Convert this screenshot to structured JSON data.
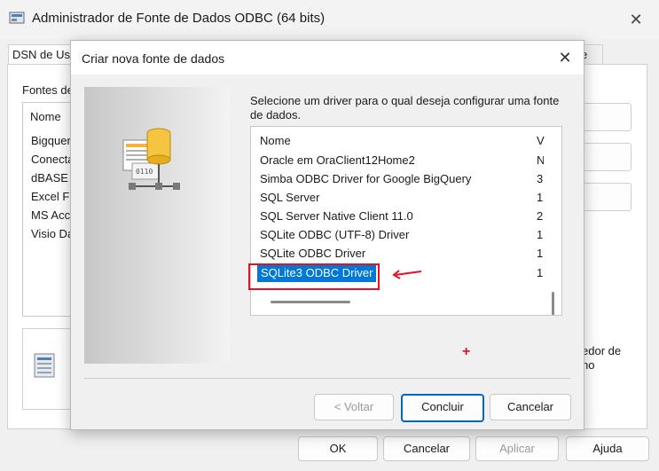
{
  "main_window": {
    "title": "Administrador de Fonte de Dados ODBC (64 bits)",
    "tab_label": "DSN de Us",
    "tab_label_right": "e",
    "fontes_label": "Fontes de",
    "list_header": "Nome",
    "list_items": [
      "Bigquer",
      "Conecta",
      "dBASE",
      "Excel Fi",
      "MS Acc",
      "Visio Da"
    ],
    "info_text_line1": "edor de",
    "info_text_line2": "no",
    "buttons": {
      "ok": "OK",
      "cancel": "Cancelar",
      "apply": "Aplicar",
      "help": "Ajuda"
    }
  },
  "dialog": {
    "title": "Criar nova fonte de dados",
    "prompt": "Selecione um driver para o qual deseja configurar uma fonte de dados.",
    "columns": {
      "name": "Nome",
      "version": "V"
    },
    "drivers": [
      {
        "name": "Oracle em OraClient12Home2",
        "version": "N"
      },
      {
        "name": "Simba ODBC Driver for Google BigQuery",
        "version": "3"
      },
      {
        "name": "SQL Server",
        "version": "1"
      },
      {
        "name": "SQL Server Native Client 11.0",
        "version": "2"
      },
      {
        "name": "SQLite ODBC (UTF-8) Driver",
        "version": "1"
      },
      {
        "name": "SQLite ODBC Driver",
        "version": "1"
      },
      {
        "name": "SQLite3 ODBC Driver",
        "version": "1"
      }
    ],
    "selected_driver": "SQLite3 ODBC Driver",
    "annotation_mark": "+",
    "buttons": {
      "back": "< Voltar",
      "finish": "Concluir",
      "cancel": "Cancelar"
    }
  },
  "colors": {
    "selection": "#0078d7",
    "annotation_red": "#e81123",
    "default_button_border": "#0067c0"
  }
}
